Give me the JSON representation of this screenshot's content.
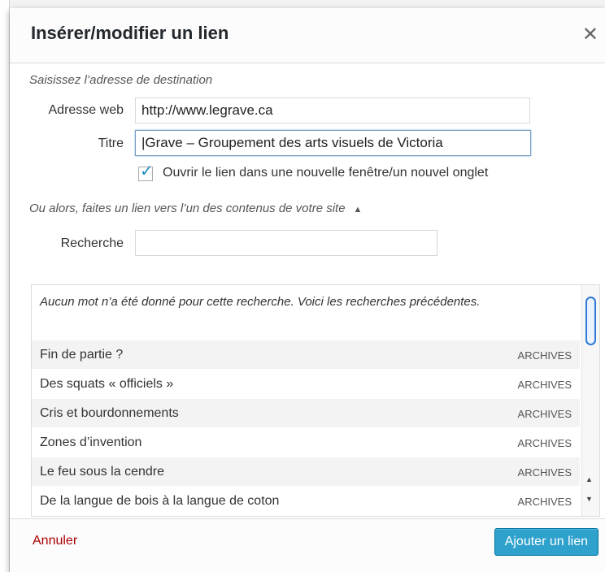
{
  "dialog": {
    "title": "Insérer/modifier un lien",
    "close_icon": "close-icon"
  },
  "form": {
    "instruction": "Saisissez l’adresse de destination",
    "url_label": "Adresse web",
    "url_value": "http://www.legrave.ca",
    "title_label": "Titre",
    "title_value": "Grave – Groupement des arts visuels de Victoria",
    "new_tab_label": "Ouvrir le lien dans une nouvelle fenêtre/un nouvel onglet",
    "new_tab_checked": true
  },
  "search": {
    "toggle_text": "Ou alors, faites un lien vers l’un des contenus de votre site",
    "toggle_icon": "triangle-up-icon",
    "label": "Recherche",
    "value": "",
    "notice": "Aucun mot n’a été donné pour cette recherche. Voici les recherches précédentes.",
    "results": [
      {
        "title": "Fin de partie ?",
        "type": "ARCHIVES"
      },
      {
        "title": "Des squats « officiels »",
        "type": "ARCHIVES"
      },
      {
        "title": "Cris et bourdonnements",
        "type": "ARCHIVES"
      },
      {
        "title": "Zones d’invention",
        "type": "ARCHIVES"
      },
      {
        "title": "Le feu sous la cendre",
        "type": "ARCHIVES"
      },
      {
        "title": "De la langue de bois à la langue de coton",
        "type": "ARCHIVES"
      }
    ]
  },
  "footer": {
    "cancel_label": "Annuler",
    "submit_label": "Ajouter un lien"
  },
  "colors": {
    "accent": "#2ea2cc",
    "cancel": "#aa0000",
    "checkbox": "#1e8cbe"
  }
}
